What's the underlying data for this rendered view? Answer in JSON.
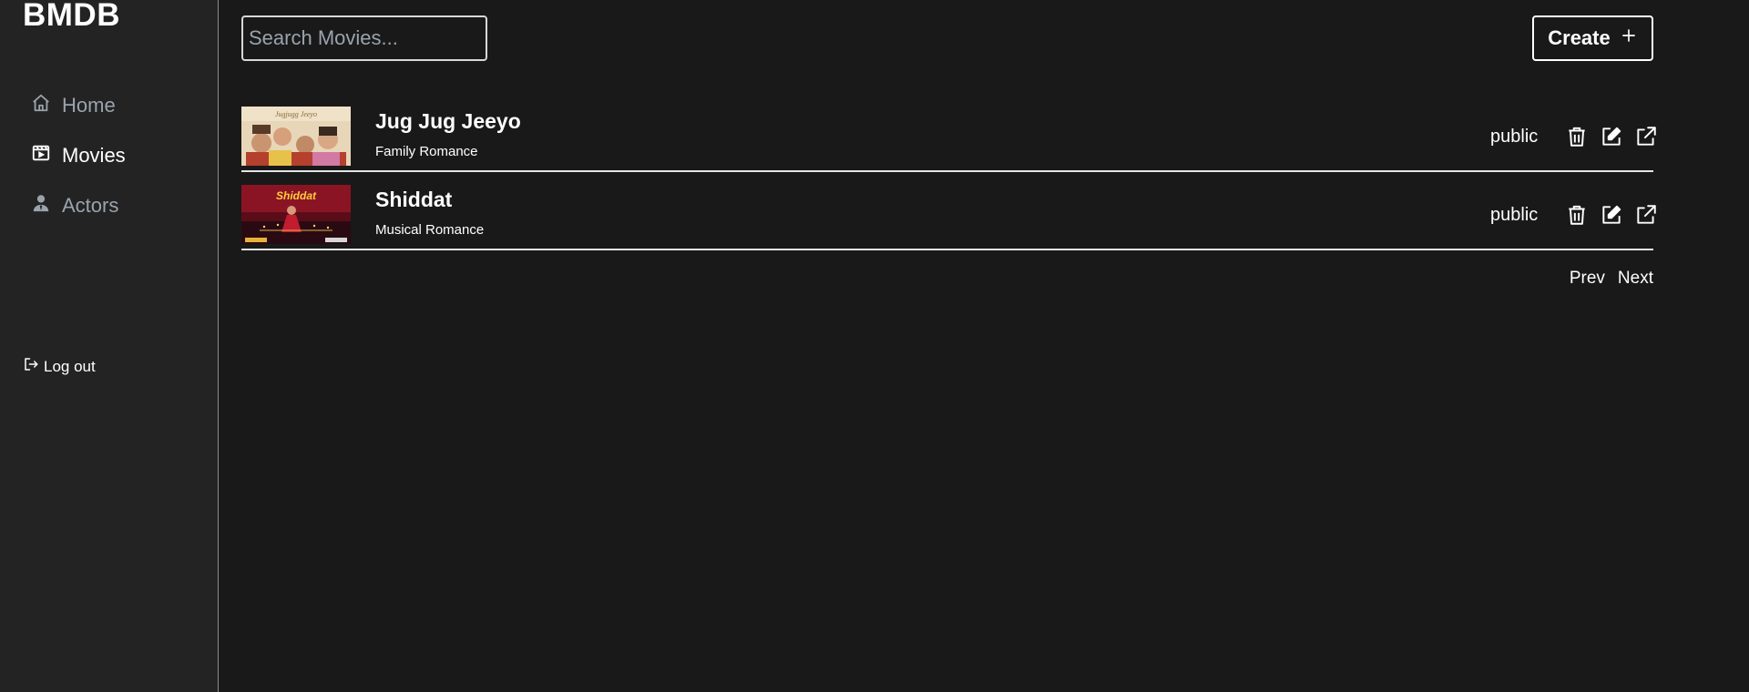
{
  "app": {
    "brand": "BMDB"
  },
  "sidebar": {
    "items": [
      {
        "label": "Home",
        "icon": "home-icon",
        "active": false
      },
      {
        "label": "Movies",
        "icon": "film-icon",
        "active": true
      },
      {
        "label": "Actors",
        "icon": "user-tie-icon",
        "active": false
      }
    ],
    "logout_label": "Log out"
  },
  "toolbar": {
    "search_placeholder": "Search Movies...",
    "create_label": "Create"
  },
  "movies": [
    {
      "title": "Jug Jug Jeeyo",
      "genres": "Family Romance",
      "status": "public"
    },
    {
      "title": "Shiddat",
      "genres": "Musical Romance",
      "status": "public"
    }
  ],
  "pagination": {
    "prev_label": "Prev",
    "next_label": "Next"
  },
  "colors": {
    "background": "#191919",
    "sidebar": "#232323",
    "text": "#ffffff",
    "muted": "#9aa3ad"
  }
}
